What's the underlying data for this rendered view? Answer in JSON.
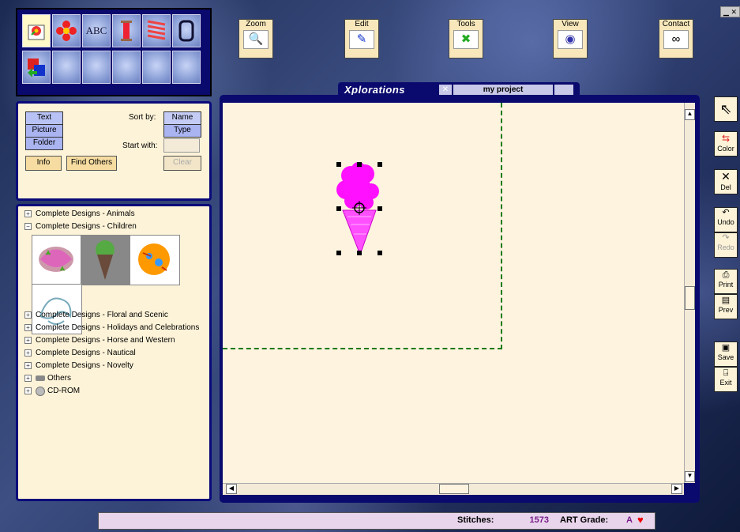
{
  "app": {
    "brand": "Xplorations",
    "project_tab": "my project"
  },
  "toolbar": {
    "zoom": "Zoom",
    "edit": "Edit",
    "tools": "Tools",
    "view": "View",
    "contact": "Contact"
  },
  "toolbox": {
    "text_tool": "ABC"
  },
  "filter": {
    "text": "Text",
    "picture": "Picture",
    "folder": "Folder",
    "sort_by": "Sort by:",
    "name": "Name",
    "type": "Type",
    "start_with": "Start with:",
    "start_with_value": "",
    "info": "Info",
    "find_others": "Find Others",
    "clear": "Clear"
  },
  "tree": {
    "animals": "Complete Designs - Animals",
    "children": "Complete Designs - Children",
    "floral": "Complete Designs - Floral and Scenic",
    "holidays": "Complete Designs - Holidays and Celebrations",
    "horse": "Complete Designs - Horse and Western",
    "nautical": "Complete Designs - Nautical",
    "novelty": "Complete Designs - Novelty",
    "others": "Others",
    "cdrom": "CD-ROM"
  },
  "side": {
    "color": "Color",
    "del": "Del",
    "undo": "Undo",
    "redo": "Redo",
    "print": "Print",
    "prev": "Prev",
    "save": "Save",
    "exit": "Exit"
  },
  "status": {
    "stitches_label": "Stitches:",
    "stitches_value": "1573",
    "grade_label": "ART Grade:",
    "grade_value": "A"
  },
  "colors": {
    "accent": "#0a0a6e",
    "canvas": "#fdf3df",
    "panel": "#fdf3d8",
    "design": "#ff00ff"
  },
  "icons": [
    "flower-shirt-icon",
    "flower-icon",
    "abc-text-icon",
    "thread-spool-icon",
    "thread-rack-icon",
    "hoop-icon",
    "convert-arrows-icon",
    "magnifier-icon",
    "pencil-icon",
    "tools-icon",
    "eye-icon",
    "glasses-icon",
    "arrow-pointer-icon",
    "color-swap-icon",
    "delete-x-icon",
    "undo-icon",
    "redo-icon",
    "printer-icon",
    "preview-icon",
    "save-disk-icon",
    "exit-door-icon",
    "heart-icon"
  ]
}
